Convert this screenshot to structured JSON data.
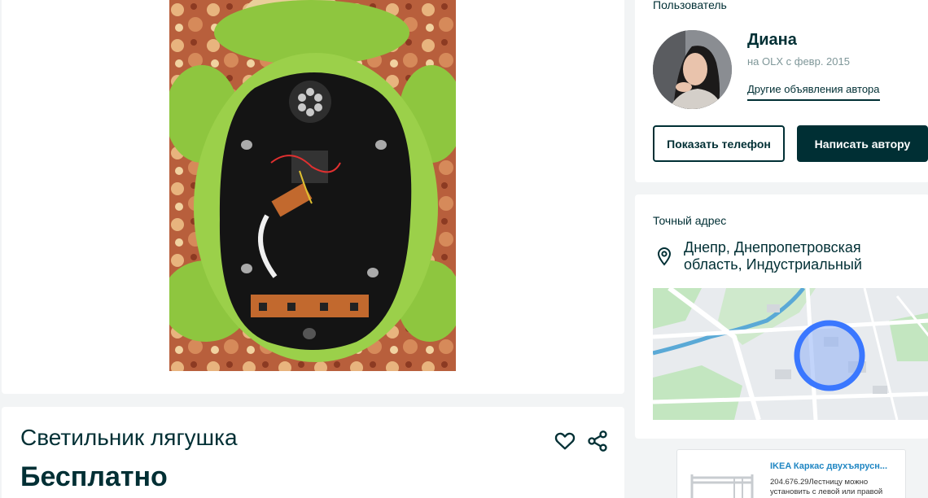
{
  "user": {
    "heading": "Пользователь",
    "name": "Диана",
    "since": "на OLX с февр. 2015",
    "other_ads": "Другие объявления автора",
    "phone_button": "Показать телефон",
    "message_button": "Написать автору"
  },
  "address": {
    "heading": "Точный адрес",
    "text": "Днепр, Днепропетровская область, Индустриальный"
  },
  "listing": {
    "title": "Светильник лягушка",
    "price": "Бесплатно"
  },
  "promo": {
    "title": "IKEA Каркас двухъярусн...",
    "description": "204.676.29Лестницу можно установить с левой или правой"
  },
  "icons": {
    "favorite": "heart-icon",
    "share": "share-icon",
    "location": "map-pin-icon"
  },
  "colors": {
    "primary": "#002f34",
    "map_circle": "#3a77ff",
    "link_blue": "#1f86c3"
  }
}
